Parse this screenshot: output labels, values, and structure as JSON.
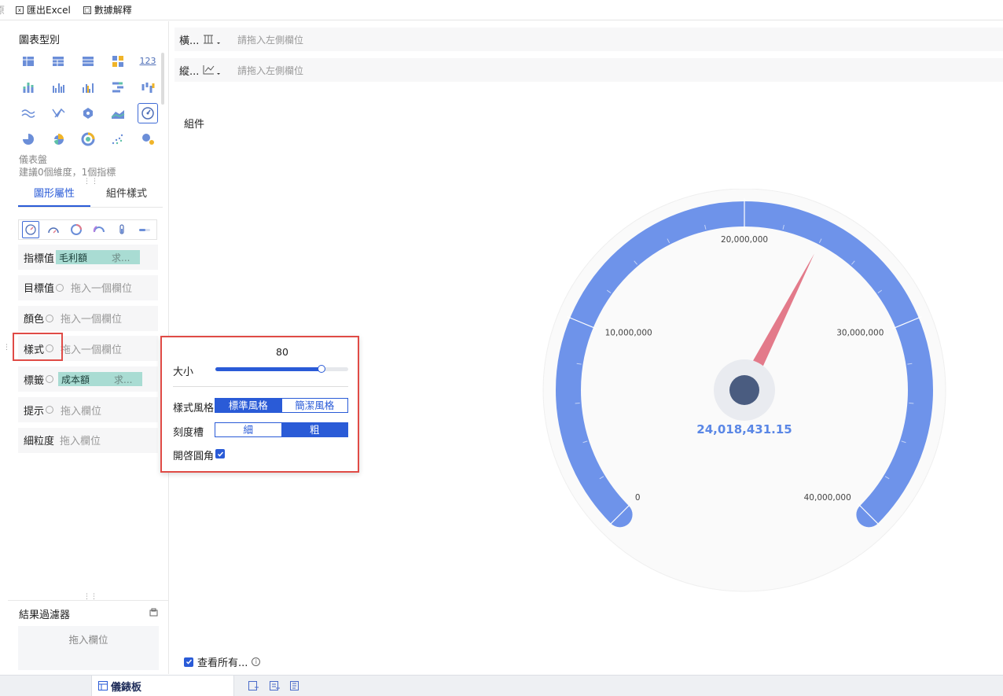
{
  "toolbar": {
    "left_fragment": "原",
    "export_excel": "匯出Excel",
    "data_explain": "數據解釋"
  },
  "left_panel": {
    "chart_type_title": "圖表型別",
    "chart_types": [
      "cross-table",
      "detail-table",
      "group-table",
      "color-table",
      "kpi-card",
      "stacked-column",
      "grouped-column",
      "multi-column",
      "compare-bar",
      "range-column",
      "line",
      "radar",
      "polygon-scatter",
      "area",
      "gauge",
      "pie",
      "rose-pie",
      "multi-pie",
      "scatter",
      "bubble"
    ],
    "active_chart_index": 14,
    "kpi_label": "123",
    "selected_name": "儀表盤",
    "selected_hint": "建議0個維度，1個指標",
    "tabs": [
      "圖形屬性",
      "組件樣式"
    ],
    "active_tab": 0,
    "gauge_subtypes": [
      "gauge-pointer",
      "gauge-half",
      "gauge-ring",
      "gauge-ring-percent",
      "gauge-test-tube",
      "gauge-slot"
    ],
    "active_subtype": 0,
    "properties": [
      {
        "label": "指標值",
        "has_gear": false,
        "field": "毛利額",
        "agg": "求...",
        "placeholder": ""
      },
      {
        "label": "目標值",
        "has_gear": true,
        "field": "",
        "agg": "",
        "placeholder": "拖入一個欄位"
      },
      {
        "label": "顏色",
        "has_gear": true,
        "field": "",
        "agg": "",
        "placeholder": "拖入一個欄位"
      },
      {
        "label": "樣式",
        "has_gear": true,
        "field": "",
        "agg": "",
        "placeholder": "拖入一個欄位"
      },
      {
        "label": "標籤",
        "has_gear": true,
        "field": "成本額",
        "agg": "求...",
        "placeholder": ""
      },
      {
        "label": "提示",
        "has_gear": true,
        "field": "",
        "agg": "",
        "placeholder": "拖入欄位"
      },
      {
        "label": "細粒度",
        "has_gear": false,
        "field": "",
        "agg": "",
        "placeholder": "拖入欄位"
      }
    ],
    "result_filter": "結果過濾器",
    "result_filter_drop": "拖入欄位"
  },
  "axes": {
    "horizontal_label": "橫...",
    "horizontal_placeholder": "請拖入左側欄位",
    "vertical_label": "縱...",
    "vertical_placeholder": "請拖入左側欄位"
  },
  "canvas": {
    "component_label": "組件",
    "view_all": "查看所有...",
    "view_all_checked": true
  },
  "popup": {
    "size_value": "80",
    "size_label": "大小",
    "size_fraction": 0.8,
    "style_label": "樣式風格",
    "style_options": [
      "標準風格",
      "簡潔風格"
    ],
    "style_selected": 0,
    "scale_label": "刻度槽",
    "scale_options": [
      "細",
      "粗"
    ],
    "scale_selected": 1,
    "round_label": "開啓圓角",
    "round_checked": true
  },
  "chart_data": {
    "type": "gauge",
    "value": 24018431.15,
    "value_label": "24,018,431.15",
    "min": 0,
    "max": 40000000,
    "ticks": [
      {
        "value": 0,
        "label": "0"
      },
      {
        "value": 10000000,
        "label": "10,000,000"
      },
      {
        "value": 20000000,
        "label": "20,000,000"
      },
      {
        "value": 30000000,
        "label": "30,000,000"
      },
      {
        "value": 40000000,
        "label": "40,000,000"
      }
    ],
    "band_color": "#6e93ea",
    "needle_color": "#e37a8a",
    "value_color": "#5a87e6"
  },
  "bottom_bar": {
    "tab_label": "儀錶板"
  },
  "colors": {
    "accent": "#2a5bd7",
    "highlight_border": "#e04b46",
    "pill": "#a9dcd3"
  }
}
